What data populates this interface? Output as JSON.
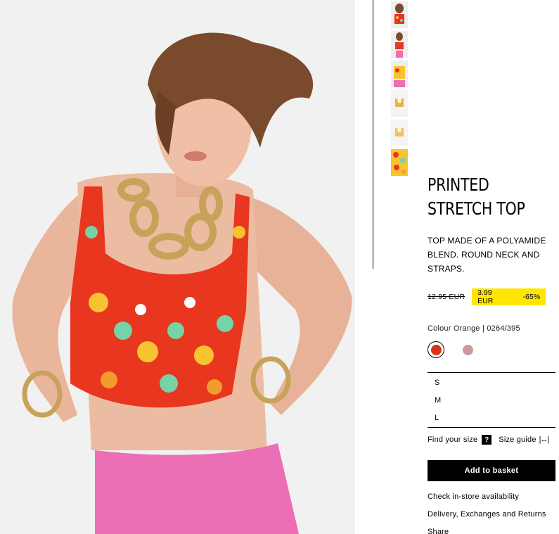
{
  "product": {
    "title_line1": "PRINTED",
    "title_line2": "STRETCH TOP",
    "description": "TOP MADE OF A POLYAMIDE BLEND. ROUND NECK AND STRAPS.",
    "old_price": "12.95 EUR",
    "sale_price": "3.99 EUR",
    "discount": "-65%",
    "colour_text": "Colour Orange | 0264/395",
    "swatches": [
      {
        "name": "Orange",
        "color": "#d8341d",
        "selected": true
      },
      {
        "name": "Pink",
        "color": "#c9999c",
        "selected": false
      }
    ],
    "sizes": [
      "S",
      "M",
      "L"
    ],
    "find_size_label": "Find your size",
    "help_glyph": "?",
    "size_guide_label": "Size guide",
    "size_guide_glyph": "|↔|",
    "add_to_basket_label": "Add to basket",
    "links": [
      "Check in-store availability",
      "Delivery, Exchanges and Returns",
      "Share"
    ]
  },
  "colors": {
    "sale_highlight": "#ffe500",
    "button_bg": "#000000",
    "top_print_red": "#e8361f",
    "skirt_pink": "#ec6eb4"
  },
  "thumbnails": [
    "thumb-model-front",
    "thumb-model-side",
    "thumb-model-pink-skirt",
    "thumb-top-flat",
    "thumb-top-flat-back",
    "thumb-print-detail"
  ]
}
